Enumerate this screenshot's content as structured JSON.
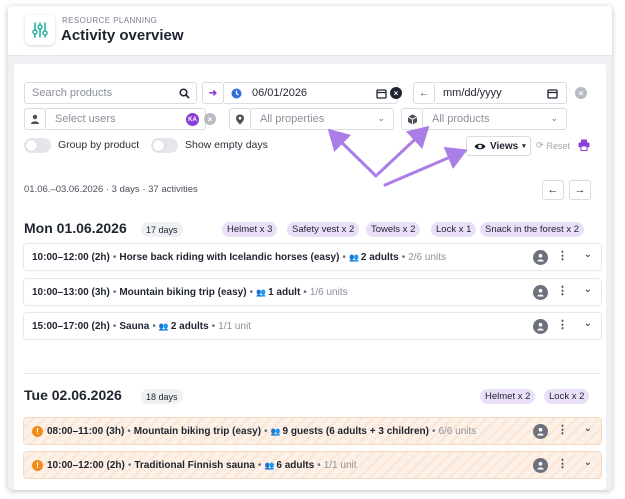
{
  "header": {
    "eyebrow": "RESOURCE PLANNING",
    "title": "Activity overview",
    "accent": "#2bb3a3"
  },
  "filters": {
    "search_placeholder": "Search products",
    "date_from": "06/01/2026",
    "date_to": "mm/dd/yyyy",
    "users_placeholder": "Select users",
    "user_badge": "KA",
    "properties": "All properties",
    "products": "All products",
    "views_label": "Views",
    "reset_label": "Reset",
    "group_by_product": "Group by product",
    "show_empty_days": "Show empty days",
    "accent": "#8b3fd9"
  },
  "summary": {
    "text": "01.06.–03.06.2026 · 3 days · 37 activities"
  },
  "days": [
    {
      "heading": "Mon 01.06.2026",
      "count": "17 days",
      "tags": [
        "Helmet x 3",
        "Safety vest x 2",
        "Towels x 2",
        "Lock x 1",
        "Snack in the forest x 2"
      ],
      "activities": [
        {
          "time": "10:00–12:00 (2h)",
          "name": "Horse back riding with Icelandic horses (easy)",
          "people": "2 adults",
          "units": "2/6 units",
          "warning": false
        },
        {
          "time": "10:00–13:00 (3h)",
          "name": "Mountain biking trip (easy)",
          "people": "1 adult",
          "units": "1/6 units",
          "warning": false
        },
        {
          "time": "15:00–17:00 (2h)",
          "name": "Sauna",
          "people": "2 adults",
          "units": "1/1 unit",
          "warning": false
        }
      ]
    },
    {
      "heading": "Tue 02.06.2026",
      "count": "18 days",
      "tags": [
        "Helmet x 2",
        "Lock x 2"
      ],
      "activities": [
        {
          "time": "08:00–11:00 (3h)",
          "name": "Mountain biking trip (easy)",
          "people": "9 guests (6 adults + 3 children)",
          "units": "6/6 units",
          "warning": true
        },
        {
          "time": "10:00–12:00 (2h)",
          "name": "Traditional Finnish sauna",
          "people": "6 adults",
          "units": "1/1 unit",
          "warning": true
        }
      ]
    }
  ],
  "colors": {
    "tag_bg": "#e9e0f7",
    "warning": "#f08a18",
    "annotation_arrows": "#a97ee6"
  },
  "icons": [
    "logo-sliders-icon",
    "search-icon",
    "arrow-right-icon",
    "clock-icon",
    "calendar-icon",
    "clear-icon",
    "arrow-left-icon",
    "user-icon",
    "location-pin-icon",
    "chevron-down-icon",
    "box-icon",
    "eye-icon",
    "reset-icon",
    "print-icon",
    "kebab-menu-icon",
    "people-icon",
    "warning-icon",
    "avatar-icon"
  ]
}
